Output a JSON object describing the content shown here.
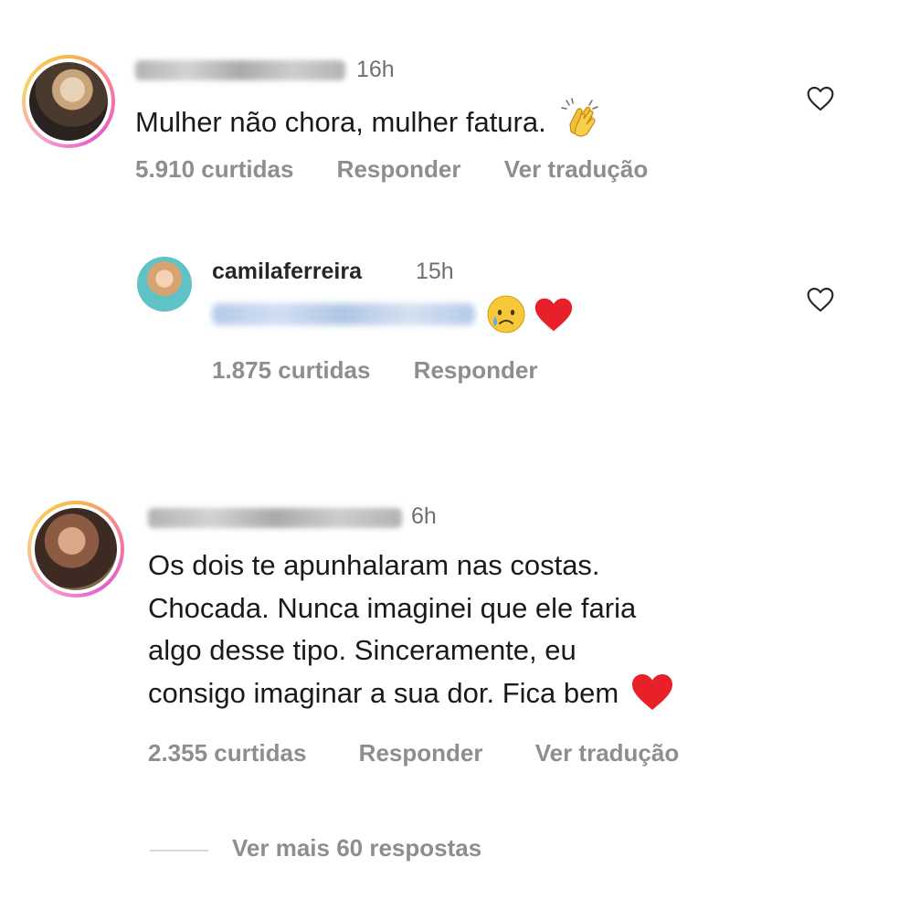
{
  "comments": [
    {
      "time": "16h",
      "text": "Mulher não chora, mulher fatura.",
      "likes": "5.910 curtidas",
      "reply_label": "Responder",
      "translate_label": "Ver tradução"
    },
    {
      "time": "6h",
      "text_lines": [
        "Os dois te apunhalaram nas costas.",
        "Chocada. Nunca imaginei que ele faria",
        "algo desse tipo. Sinceramente, eu",
        "consigo imaginar a sua dor. Fica bem"
      ],
      "likes": "2.355 curtidas",
      "reply_label": "Responder",
      "translate_label": "Ver tradução"
    }
  ],
  "reply": {
    "username": "camilaferreira",
    "time": "15h",
    "likes": "1.875 curtidas",
    "reply_label": "Responder"
  },
  "view_more_label": "Ver mais 60 respostas",
  "icons": {
    "like": "heart-outline-icon",
    "clap": "clapping-hands-emoji",
    "tear": "crying-face-emoji",
    "heart": "red-heart-emoji"
  },
  "colors": {
    "username": "#262626",
    "meta": "#8e8e8e",
    "heart_emoji": "#e8202a"
  }
}
